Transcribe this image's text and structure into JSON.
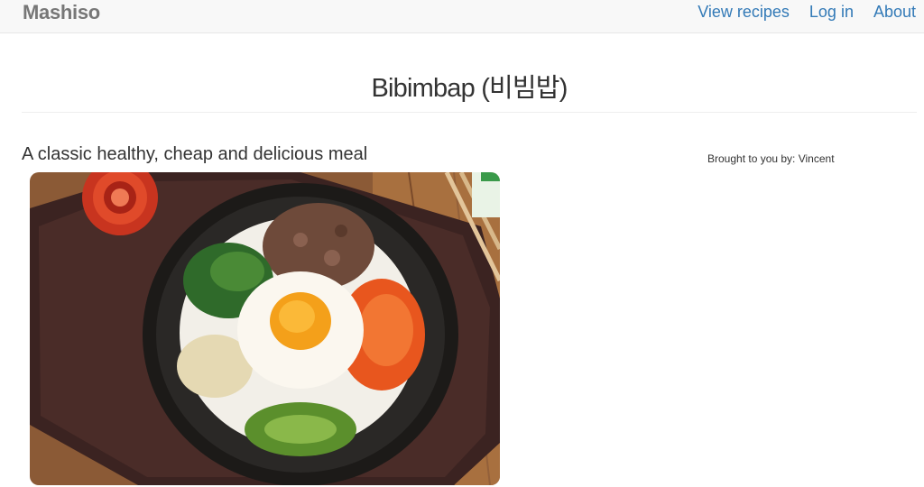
{
  "navbar": {
    "brand": "Mashiso",
    "links": [
      "View recipes",
      "Log in",
      "About"
    ]
  },
  "recipe": {
    "title": "Bibimbap (비빔밥)",
    "subtitle": "A classic healthy, cheap and delicious meal",
    "author_credit": "Brought to you by: Vincent"
  },
  "colors": {
    "link": "#337ab7",
    "brand": "#777777",
    "navbar_bg": "#f8f8f8"
  }
}
